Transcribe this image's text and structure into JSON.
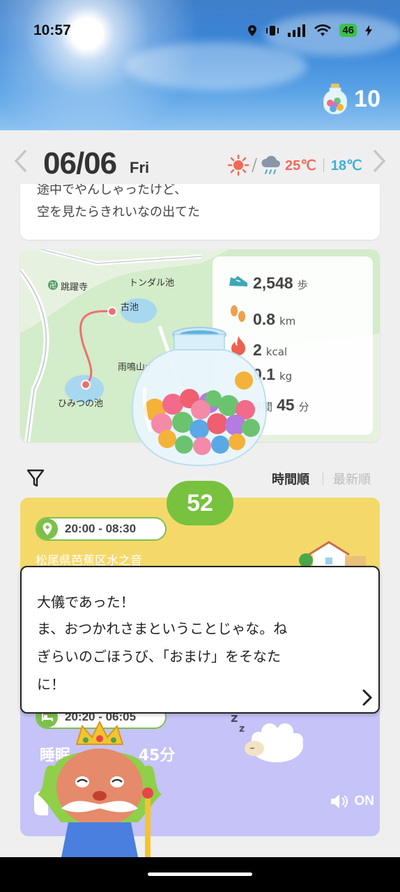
{
  "status_bar": {
    "time": "10:57",
    "battery": "46"
  },
  "header": {
    "candy_count": "10"
  },
  "date_nav": {
    "date": "06/06",
    "weekday": "Fri",
    "temp_high": "25℃",
    "temp_low": "18℃"
  },
  "diary": {
    "line1": "途中でやんしゃったけど、",
    "line2": "空を見たらきれいなの出てた"
  },
  "map": {
    "labels": {
      "temple": "跳躍寺",
      "tondaru": "トンダル池",
      "furuike": "古池",
      "amanari": "雨鳴山ナ",
      "himitsu": "ひみつの池"
    },
    "stats": {
      "steps": {
        "value": "2,548",
        "unit": "歩"
      },
      "distance": {
        "value": "0.8",
        "unit": "km"
      },
      "calories": {
        "value": "2",
        "unit": "kcal"
      },
      "weight": {
        "value": "0.1",
        "unit": "kg"
      },
      "time": {
        "label": "時間",
        "value": "45",
        "unit": "分"
      }
    }
  },
  "sort": {
    "by_time": "時間順",
    "by_newest": "最新順"
  },
  "timeline": {
    "badge": "52",
    "place": {
      "time_range": "20:00 - 08:30",
      "name": "松尾県芭蕉区水之音"
    },
    "sleep": {
      "time_range": "20:20 - 06:05",
      "label": "睡眠",
      "duration": "45分",
      "sound": "ON"
    }
  },
  "dialog": {
    "line1": "大儀であった！",
    "line2": "ま、おつかれさまということじゃな。ね",
    "line3": "ぎらいのごほうび、「おまけ」をそなた",
    "line4": "に！"
  }
}
